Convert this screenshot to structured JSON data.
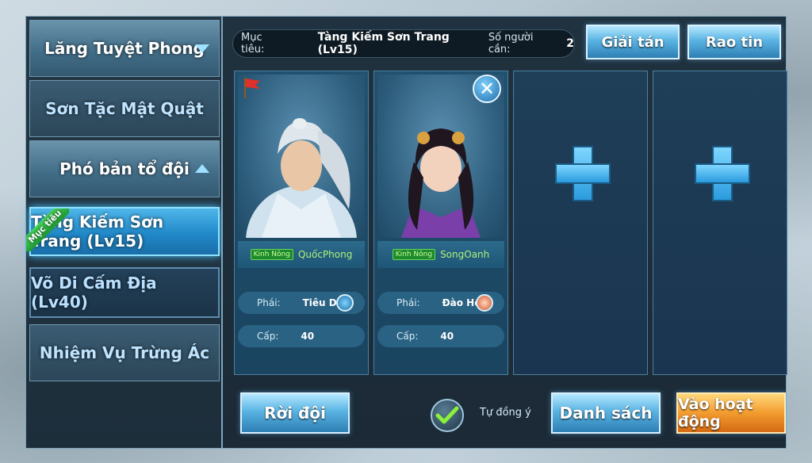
{
  "menu": {
    "items": [
      {
        "label": "Lăng Tuyệt Phong"
      },
      {
        "label": "Sơn Tặc Mật Quật"
      },
      {
        "label": "Phó bản tổ đội"
      },
      {
        "label": "Tàng Kiếm Sơn Trang (Lv15)",
        "ribbon": "Mục tiêu"
      },
      {
        "label": "Võ Di Cấm Địa (Lv40)"
      },
      {
        "label": "Nhiệm Vụ Trừng Ác"
      }
    ]
  },
  "target": {
    "label": "Mục tiêu:",
    "value": "Tàng Kiếm Sơn Trang (Lv15)",
    "count_label": "Số người cần:",
    "count": "2"
  },
  "buttons": {
    "disband": "Giải tán",
    "broadcast": "Rao tin",
    "leave": "Rời đội",
    "list": "Danh sách",
    "enter": "Vào hoạt động"
  },
  "auto_accept": {
    "label": "Tự đồng ý",
    "checked": true
  },
  "members": [
    {
      "tag": "Kinh Nông",
      "name": "QuốcPhong",
      "school_label": "Phái:",
      "school": "Tiêu Dao",
      "level_label": "Cấp:",
      "level": "40",
      "is_leader": true
    },
    {
      "tag": "Kinh Nông",
      "name": "SongOanh",
      "school_label": "Phái:",
      "school": "Đào Hoa",
      "level_label": "Cấp:",
      "level": "40",
      "is_leader": false
    }
  ],
  "colors": {
    "accent_blue": "#2d7fb4",
    "accent_orange": "#f29b2f",
    "name_green": "#aef07a"
  }
}
